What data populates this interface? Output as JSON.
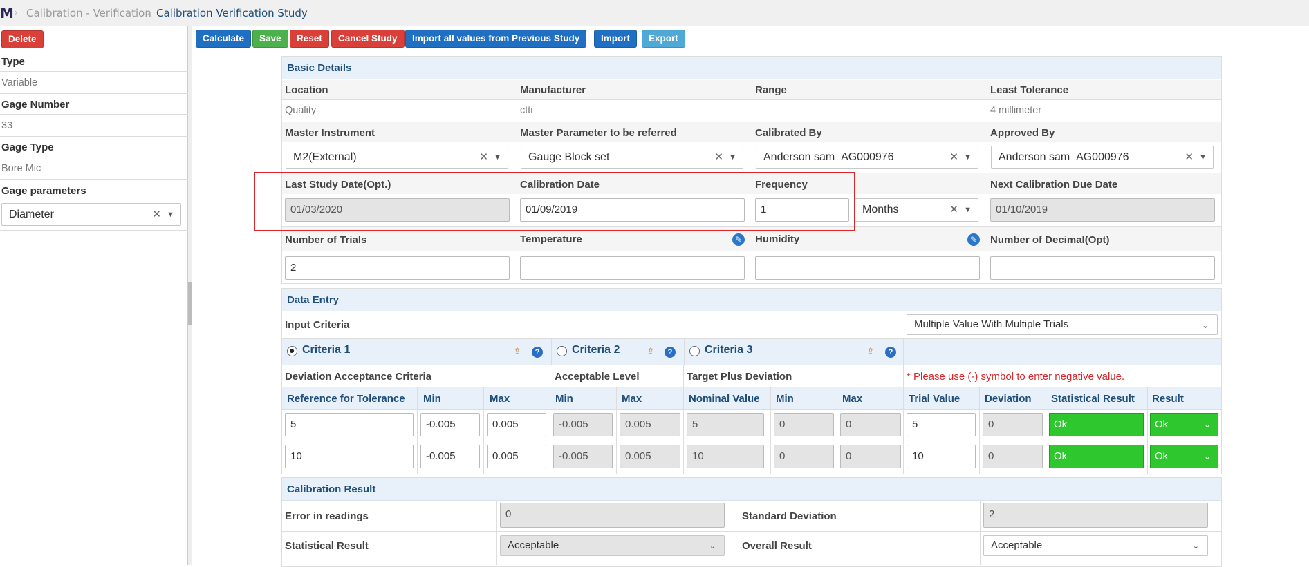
{
  "breadcrumb": {
    "logo": "M",
    "parent": "Calibration - Verification",
    "current": "Calibration Verification Study"
  },
  "toolbar": {
    "delete": "Delete",
    "calculate": "Calculate",
    "save": "Save",
    "reset": "Reset",
    "cancel_study": "Cancel Study",
    "import_prev": "Import all values from Previous Study",
    "import": "Import",
    "export": "Export"
  },
  "left": {
    "type_label": "Type",
    "type_value": "Variable",
    "gage_number_label": "Gage Number",
    "gage_number_value": "33",
    "gage_type_label": "Gage Type",
    "gage_type_value": "Bore Mic",
    "gage_params_label": "Gage parameters",
    "gage_params_value": "Diameter"
  },
  "basic": {
    "title": "Basic Details",
    "location_label": "Location",
    "location_value": "Quality",
    "manufacturer_label": "Manufacturer",
    "manufacturer_value": "ctti",
    "range_label": "Range",
    "range_value": "",
    "least_tol_label": "Least Tolerance",
    "least_tol_value": "4 millimeter",
    "master_instr_label": "Master Instrument",
    "master_instr_value": "M2(External)",
    "master_param_label": "Master Parameter to be referred",
    "master_param_value": "Gauge Block set",
    "calibrated_by_label": "Calibrated By",
    "calibrated_by_value": "Anderson sam_AG000976",
    "approved_by_label": "Approved By",
    "approved_by_value": "Anderson sam_AG000976",
    "last_study_label": "Last Study Date(Opt.)",
    "last_study_value": "01/03/2020",
    "cal_date_label": "Calibration Date",
    "cal_date_value": "01/09/2019",
    "frequency_label": "Frequency",
    "frequency_value": "1",
    "frequency_unit": "Months",
    "next_due_label": "Next Calibration Due Date",
    "next_due_value": "01/10/2019",
    "trials_label": "Number of Trials",
    "trials_value": "2",
    "temperature_label": "Temperature",
    "temperature_value": "",
    "humidity_label": "Humidity",
    "humidity_value": "",
    "decimal_label": "Number of Decimal(Opt)",
    "decimal_value": ""
  },
  "data_entry": {
    "title": "Data Entry",
    "input_criteria_label": "Input Criteria",
    "input_criteria_value": "Multiple Value With Multiple Trials",
    "criteria": [
      "Criteria 1",
      "Criteria 2",
      "Criteria 3"
    ],
    "group_dev": "Deviation Acceptance Criteria",
    "group_accept": "Acceptable Level",
    "group_target": "Target Plus Deviation",
    "note": "* Please use (-) symbol to enter negative value.",
    "headers": [
      "Reference for Tolerance",
      "Min",
      "Max",
      "Min",
      "Max",
      "Nominal Value",
      "Min",
      "Max",
      "Trial Value",
      "Deviation",
      "Statistical Result",
      "Result"
    ],
    "rows": [
      {
        "ref": "5",
        "dmin": "-0.005",
        "dmax": "0.005",
        "amin": "-0.005",
        "amax": "0.005",
        "nominal": "5",
        "tmin": "0",
        "tmax": "0",
        "trial": "5",
        "deviation": "0",
        "stat": "Ok",
        "result": "Ok"
      },
      {
        "ref": "10",
        "dmin": "-0.005",
        "dmax": "0.005",
        "amin": "-0.005",
        "amax": "0.005",
        "nominal": "10",
        "tmin": "0",
        "tmax": "0",
        "trial": "10",
        "deviation": "0",
        "stat": "Ok",
        "result": "Ok"
      }
    ]
  },
  "result": {
    "title": "Calibration Result",
    "error_label": "Error in readings",
    "error_value": "0",
    "std_label": "Standard Deviation",
    "std_value": "2",
    "stat_label": "Statistical Result",
    "stat_value": "Acceptable",
    "overall_label": "Overall Result",
    "overall_value": "Acceptable"
  },
  "colors": {
    "primary": "#1f6fc2",
    "success": "#4cb04c",
    "danger": "#d9403a",
    "info": "#4fa9d6",
    "ok_green": "#2ec82e",
    "highlight": "#d9262b",
    "header_text": "#1f4e79"
  }
}
